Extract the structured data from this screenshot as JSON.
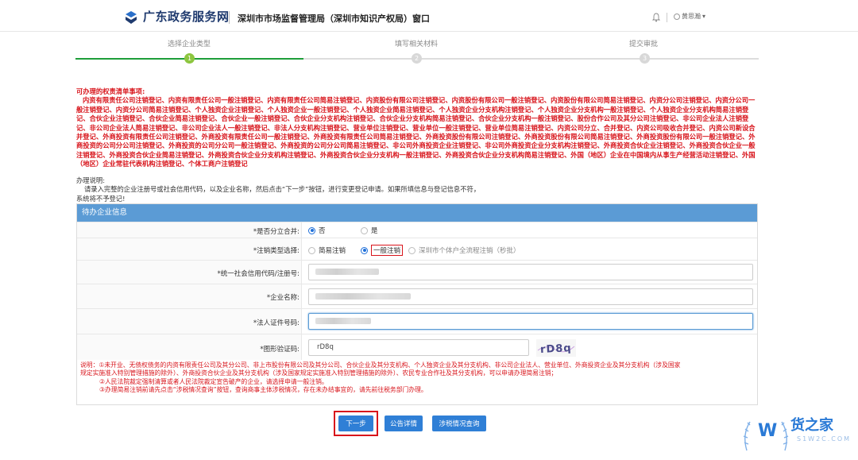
{
  "header": {
    "site_title": "广东政务服务网",
    "department": "深圳市市场监督管理局（深圳市知识产权局）窗口",
    "user_name": "黄思瀚",
    "colors": {
      "brand": "#1f3a6e"
    }
  },
  "steps": [
    {
      "label": "选择企业类型",
      "number": "1",
      "active": true
    },
    {
      "label": "填写相关材料",
      "number": "2",
      "active": false
    },
    {
      "label": "提交审批",
      "number": "3",
      "active": false
    }
  ],
  "notice": {
    "title": "可办理的权责清单事项:",
    "body": "内资有限责任公司注销登记、内资有限责任公司一般注销登记、内资有限责任公司简易注销登记、内资股份有限公司注销登记、内资股份有限公司一般注销登记、内资股份有限公司简易注销登记、内资分公司注销登记、内资分公司一般注销登记、内资分公司简易注销登记、个人独资企业注销登记、个人独资企业一般注销登记、个人独资企业简易注销登记、个人独资企业分支机构注销登记、个人独资企业分支机构一般注销登记、个人独资企业分支机构简易注销登记、合伙企业注销登记、合伙企业简易注销登记、合伙企业一般注销登记、合伙企业分支机构注销登记、合伙企业分支机构简易注销登记、合伙企业分支机构一般注销登记、股份合作公司及其分公司注销登记、非公司企业法人注销登记、非公司企业法人简易注销登记、非公司企业法人一般注销登记、非法人分支机构注销登记、营业单位注销登记、营业单位一般注销登记、营业单位简易注销登记、内资公司分立、合并登记、内资公司吸收合并登记、内资公司新设合并登记、外商投资有限责任公司注销登记、外商投资有限责任公司一般注销登记、外商投资有限责任公司简易注销登记、外商投资股份有限公司注销登记、外商投资股份有限公司简易注销登记、外商投资股份有限公司一般注销登记、外商投资的公司分公司注销登记、外商投资的公司分公司一般注销登记、外商投资的公司分公司简易注销登记、非公司外商投资企业注销登记、非公司外商投资企业分支机构注销登记、外商投资合伙企业注销登记、外商投资合伙企业一般注销登记、外商投资合伙企业简易注销登记、外商投资合伙企业分支机构注销登记、外商投资合伙企业分支机构一般注销登记、外商投资合伙企业分支机构简易注销登记、外国（地区）企业在中国境内从事生产经营活动注销登记、外国（地区）企业常驻代表机构注销登记、个体工商户注销登记"
  },
  "guide": {
    "title": "办理说明:",
    "line1": "请录入完整的企业注册号或社会信用代码，以及企业名称，然后点击“下一步”按钮，进行变更登记申请。如果所填信息与登记信息不符，",
    "line2": "系统将不予登记!"
  },
  "form": {
    "panel_title": "待办企业信息",
    "split_merge": {
      "label": "*是否分立合并:",
      "options": [
        "否",
        "是"
      ],
      "selected": "否"
    },
    "cancel_type": {
      "label": "*注销类型选择:",
      "options": [
        "简易注销",
        "一般注销",
        "深圳市个体户全流程注销（秒批）"
      ],
      "selected": "一般注销"
    },
    "credit_code": {
      "label": "*统一社会信用代码/注册号:"
    },
    "company_name": {
      "label": "*企业名称:"
    },
    "legal_id": {
      "label": "*法人证件号码:"
    },
    "captcha": {
      "label": "*图形验证码:",
      "value": "rD8q",
      "image_text": "rD8q"
    },
    "remark": {
      "line1": "说明：①未开业、无债权债务的内资有限责任公司及其分公司、非上市股份有限公司及其分公司、合伙企业及其分支机构、个人独资企业及其分支机构、非公司企业法人、营业单位、外商投资企业及其分支机构（涉及国家",
      "line2": "规定实施准入特别管理措施的除外）、外商投资合伙企业及其分支机构（涉及国家规定实施准入特别管理措施的除外）、农民专业合作社及其分支机构，可以申请办理简易注销；",
      "line3": "②人民法院裁定强制清算或者人民法院裁定宣告破产的企业，请选择申请一般注销。",
      "line4": "③办理简易注销前请先点击“涉税情况查询”按钮，查询商事主体涉税情况，存在未办结事宜的，请先前往税务部门办理。"
    }
  },
  "buttons": {
    "next": "下一步",
    "announcement": "公告详情",
    "tax_query": "涉税情况查询"
  },
  "watermark": {
    "text": "货之家",
    "sub": "S1W2C.COM"
  }
}
